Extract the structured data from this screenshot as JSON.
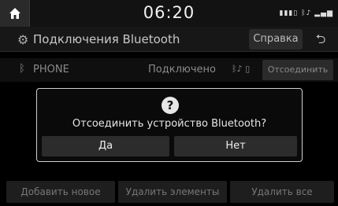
{
  "status_bar": {
    "time": "06:20",
    "icons": [
      "battery-icon",
      "bluetooth-audio-icon",
      "signal-icon"
    ]
  },
  "title_bar": {
    "icon": "gear-icon",
    "title": "Подключения Bluetooth",
    "help_label": "Справка",
    "back_icon": "back-arrow-icon"
  },
  "device": {
    "icon": "bluetooth-icon",
    "name": "PHONE",
    "status": "Подключено",
    "disconnect_label": "Отсоединить"
  },
  "bottom_bar": {
    "add_label": "Добавить новое",
    "delete_items_label": "Удалить элементы",
    "delete_all_label": "Удалить все"
  },
  "dialog": {
    "icon": "question-icon",
    "message": "Отсоединить устройство Bluetooth?",
    "yes_label": "Да",
    "no_label": "Нет"
  }
}
